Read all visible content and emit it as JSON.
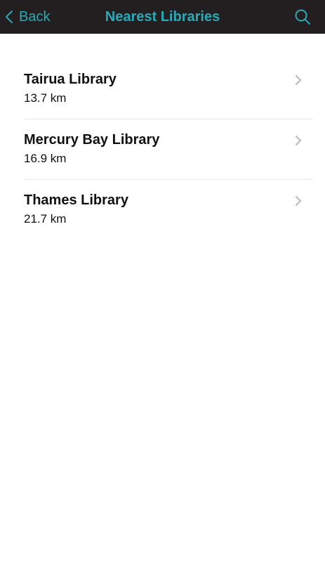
{
  "nav": {
    "back_label": "Back",
    "title": "Nearest Libraries",
    "accent_color": "#2aa9b6",
    "bar_color": "#231f20",
    "back_icon": "chevron-left-icon",
    "search_icon": "search-icon"
  },
  "libraries": [
    {
      "name": "Tairua Library",
      "distance": "13.7 km"
    },
    {
      "name": "Mercury Bay Library",
      "distance": "16.9 km"
    },
    {
      "name": "Thames Library",
      "distance": "21.7 km"
    }
  ]
}
